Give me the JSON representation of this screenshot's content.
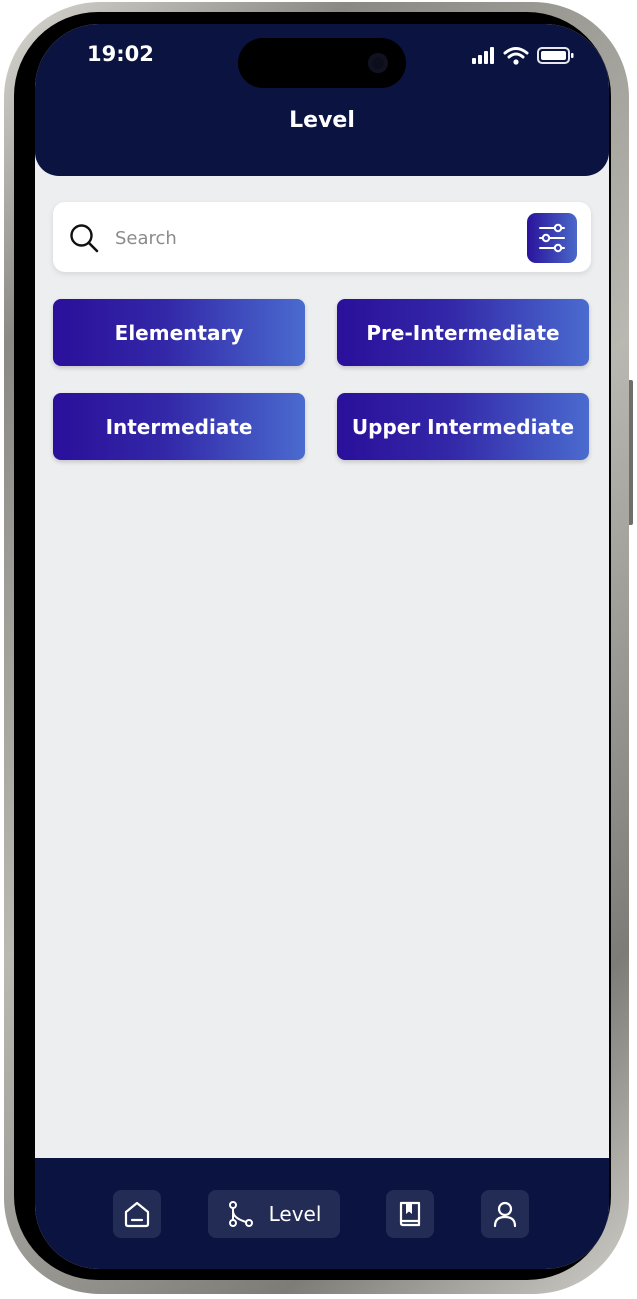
{
  "status_bar": {
    "time": "19:02",
    "icons": [
      "signal-icon",
      "wifi-icon",
      "battery-icon"
    ]
  },
  "header": {
    "title": "Level"
  },
  "search": {
    "placeholder": "Search",
    "value": ""
  },
  "filter": {
    "icon": "sliders-icon"
  },
  "levels": [
    {
      "label": "Elementary"
    },
    {
      "label": "Pre-Intermediate"
    },
    {
      "label": "Intermediate"
    },
    {
      "label": "Upper Intermediate"
    }
  ],
  "bottom_nav": {
    "items": [
      {
        "icon": "home-icon",
        "label": ""
      },
      {
        "icon": "route-icon",
        "label": "Level",
        "active": true
      },
      {
        "icon": "book-icon",
        "label": ""
      },
      {
        "icon": "user-icon",
        "label": ""
      }
    ]
  },
  "colors": {
    "header_bg": "#0b1340",
    "page_bg": "#edeef0",
    "button_gradient_start": "#2a0f9a",
    "button_gradient_end": "#4a6bcf",
    "nav_item_bg": "#232c55"
  }
}
